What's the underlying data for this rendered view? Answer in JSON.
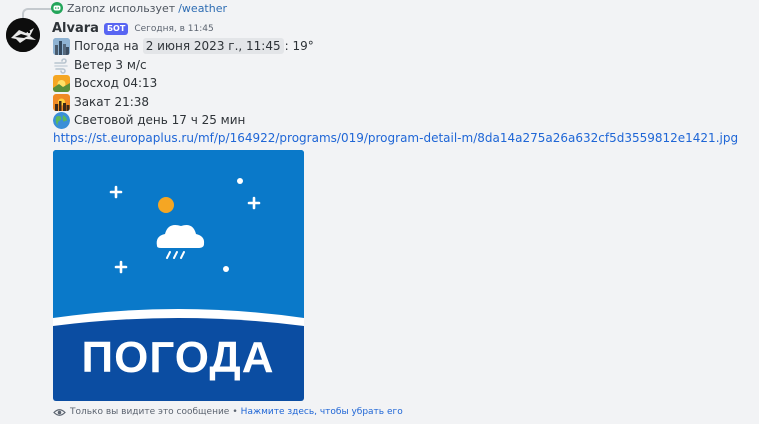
{
  "reply": {
    "user": "Zaronz",
    "text": "использует",
    "command": "/weather"
  },
  "message": {
    "username": "Alvara",
    "bot_tag": "БОТ",
    "timestamp": "Сегодня, в 11:45",
    "weather_prefix": "Погода на",
    "date": "2 июня 2023 г., 11:45",
    "temperature_suffix": ": 19°",
    "wind": "Ветер 3 м/с",
    "sunrise": "Восход 04:13",
    "sunset": "Закат 21:38",
    "daylight": "Световой день 17 ч 25 мин",
    "link": "https://st.europaplus.ru/mf/p/164922/programs/019/program-detail-m/8da14a275a26a632cf5d3559812e1421.jpg",
    "image_text": "ПОГОДА"
  },
  "footer": {
    "notice": "Только вы видите это сообщение",
    "separator": "•",
    "dismiss": "Нажмите здесь, чтобы убрать его"
  },
  "icons": {
    "reply": "discord-icon",
    "weather": "cityscape-icon",
    "wind": "wind-icon",
    "sunrise": "sunrise-icon",
    "sunset": "sunset-icon",
    "daylight": "globe-icon",
    "visibility": "eye-icon"
  },
  "colors": {
    "background": "#f2f3f5",
    "link": "#1f66d6",
    "bot_tag": "#5865f2",
    "image_blue": "#0a79c9",
    "image_dark_blue": "#0b4da2"
  }
}
